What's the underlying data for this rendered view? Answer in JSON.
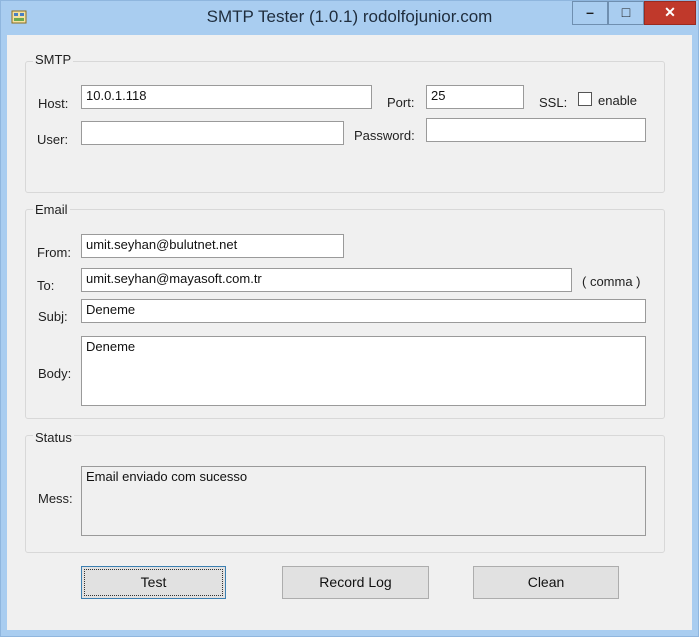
{
  "window": {
    "title": "SMTP Tester (1.0.1)    rodolfojunior.com",
    "buttons": {
      "minimize": "–",
      "maximize": "□",
      "close": "✕"
    }
  },
  "smtp": {
    "legend": "SMTP",
    "host_label": "Host:",
    "host_value": "10.0.1.118",
    "port_label": "Port:",
    "port_value": "25",
    "ssl_label": "SSL:",
    "ssl_checkbox_label": "enable",
    "ssl_checked": false,
    "user_label": "User:",
    "user_value": "",
    "password_label": "Password:",
    "password_value": ""
  },
  "email": {
    "legend": "Email",
    "from_label": "From:",
    "from_value": "umit.seyhan@bulutnet.net",
    "to_label": "To:",
    "to_value": "umit.seyhan@mayasoft.com.tr",
    "to_hint": "( comma )",
    "subj_label": "Subj:",
    "subj_value": "Deneme",
    "body_label": "Body:",
    "body_value": "Deneme"
  },
  "status": {
    "legend": "Status",
    "mess_label": "Mess:",
    "mess_value": "Email enviado com sucesso"
  },
  "buttons": {
    "test": "Test",
    "record_log": "Record Log",
    "clean": "Clean"
  }
}
